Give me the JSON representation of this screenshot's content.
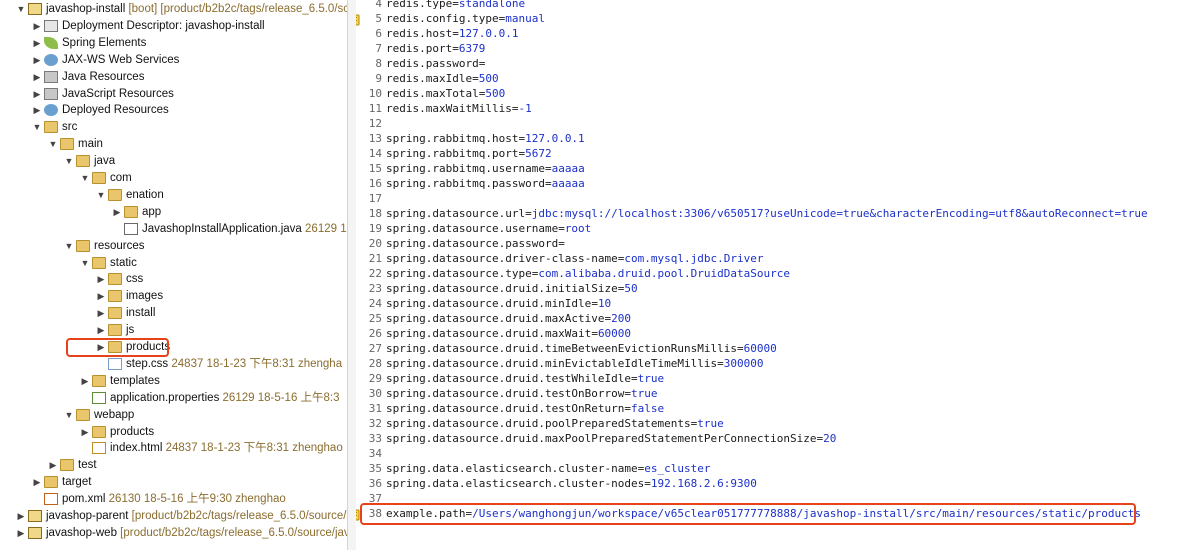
{
  "project_explorer": {
    "items": [
      {
        "label": "javashop-install",
        "annotation": "[boot] [product/b2b2c/tags/release_6.5.0/sc",
        "icon": "project-icon",
        "depth": 0,
        "expanded": true
      },
      {
        "label": "Deployment Descriptor: javashop-install",
        "annotation": "",
        "icon": "deployment-descriptor-icon",
        "depth": 1,
        "expanded": false
      },
      {
        "label": "Spring Elements",
        "annotation": "",
        "icon": "spring-leaf-icon",
        "depth": 1,
        "expanded": false
      },
      {
        "label": "JAX-WS Web Services",
        "annotation": "",
        "icon": "web-services-icon",
        "depth": 1,
        "expanded": false
      },
      {
        "label": "Java Resources",
        "annotation": "",
        "icon": "java-resources-icon",
        "depth": 1,
        "expanded": false
      },
      {
        "label": "JavaScript Resources",
        "annotation": "",
        "icon": "javascript-resources-icon",
        "depth": 1,
        "expanded": false
      },
      {
        "label": "Deployed Resources",
        "annotation": "",
        "icon": "deployed-resources-icon",
        "depth": 1,
        "expanded": false
      },
      {
        "label": "src",
        "annotation": "",
        "icon": "folder-icon",
        "depth": 1,
        "expanded": true
      },
      {
        "label": "main",
        "annotation": "",
        "icon": "folder-icon",
        "depth": 2,
        "expanded": true
      },
      {
        "label": "java",
        "annotation": "",
        "icon": "folder-icon",
        "depth": 3,
        "expanded": true
      },
      {
        "label": "com",
        "annotation": "",
        "icon": "folder-icon",
        "depth": 4,
        "expanded": true
      },
      {
        "label": "enation",
        "annotation": "",
        "icon": "folder-icon",
        "depth": 5,
        "expanded": true
      },
      {
        "label": "app",
        "annotation": "",
        "icon": "folder-icon",
        "depth": 6,
        "expanded": false
      },
      {
        "label": "JavashopInstallApplication.java",
        "annotation": "26129  18",
        "icon": "java-file-icon",
        "depth": 6,
        "expanded": null
      },
      {
        "label": "resources",
        "annotation": "",
        "icon": "folder-icon",
        "depth": 3,
        "expanded": true
      },
      {
        "label": "static",
        "annotation": "",
        "icon": "folder-icon",
        "depth": 4,
        "expanded": true
      },
      {
        "label": "css",
        "annotation": "",
        "icon": "folder-icon",
        "depth": 5,
        "expanded": false
      },
      {
        "label": "images",
        "annotation": "",
        "icon": "folder-icon",
        "depth": 5,
        "expanded": false
      },
      {
        "label": "install",
        "annotation": "",
        "icon": "folder-icon",
        "depth": 5,
        "expanded": false
      },
      {
        "label": "js",
        "annotation": "",
        "icon": "folder-icon",
        "depth": 5,
        "expanded": false
      },
      {
        "label": "products",
        "annotation": "",
        "icon": "folder-icon",
        "depth": 5,
        "expanded": false
      },
      {
        "label": "step.css",
        "annotation": "24837  18-1-23 下午8:31  zhengha",
        "icon": "css-file-icon",
        "depth": 5,
        "expanded": null
      },
      {
        "label": "templates",
        "annotation": "",
        "icon": "folder-icon",
        "depth": 4,
        "expanded": false
      },
      {
        "label": "application.properties",
        "annotation": "26129  18-5-16 上午8:3",
        "icon": "properties-file-icon",
        "depth": 4,
        "expanded": null
      },
      {
        "label": "webapp",
        "annotation": "",
        "icon": "folder-icon",
        "depth": 3,
        "expanded": true
      },
      {
        "label": "products",
        "annotation": "",
        "icon": "folder-icon",
        "depth": 4,
        "expanded": false
      },
      {
        "label": "index.html",
        "annotation": "24837  18-1-23 下午8:31  zhenghao",
        "icon": "html-file-icon",
        "depth": 4,
        "expanded": null
      },
      {
        "label": "test",
        "annotation": "",
        "icon": "folder-icon",
        "depth": 2,
        "expanded": false
      },
      {
        "label": "target",
        "annotation": "",
        "icon": "folder-icon",
        "depth": 1,
        "expanded": false
      },
      {
        "label": "pom.xml",
        "annotation": "26130  18-5-16 上午9:30  zhenghao",
        "icon": "xml-file-icon",
        "depth": 1,
        "expanded": null
      },
      {
        "label": "javashop-parent",
        "annotation": "[product/b2b2c/tags/release_6.5.0/source/p",
        "icon": "project-icon",
        "depth": 0,
        "expanded": false
      },
      {
        "label": "javashop-web",
        "annotation": "[product/b2b2c/tags/release_6.5.0/source/jav",
        "icon": "project-icon",
        "depth": 0,
        "expanded": false
      }
    ]
  },
  "editor": {
    "lines": [
      {
        "num": "4",
        "key": "redis.type",
        "value": "standalone"
      },
      {
        "num": "5",
        "key": "redis.config.type",
        "value": "manual"
      },
      {
        "num": "6",
        "key": "redis.host",
        "value": "127.0.0.1"
      },
      {
        "num": "7",
        "key": "redis.port",
        "value": "6379"
      },
      {
        "num": "8",
        "key": "redis.password",
        "value": ""
      },
      {
        "num": "9",
        "key": "redis.maxIdle",
        "value": "500"
      },
      {
        "num": "10",
        "key": "redis.maxTotal",
        "value": "500"
      },
      {
        "num": "11",
        "key": "redis.maxWaitMillis",
        "value": "-1"
      },
      {
        "num": "12",
        "key": "",
        "value": ""
      },
      {
        "num": "13",
        "key": "spring.rabbitmq.host",
        "value": "127.0.0.1"
      },
      {
        "num": "14",
        "key": "spring.rabbitmq.port",
        "value": "5672"
      },
      {
        "num": "15",
        "key": "spring.rabbitmq.username",
        "value": "aaaaa"
      },
      {
        "num": "16",
        "key": "spring.rabbitmq.password",
        "value": "aaaaa"
      },
      {
        "num": "17",
        "key": "",
        "value": ""
      },
      {
        "num": "18",
        "key": "spring.datasource.url",
        "value": "jdbc:mysql://localhost:3306/v650517?useUnicode=true&characterEncoding=utf8&autoReconnect=true"
      },
      {
        "num": "19",
        "key": "spring.datasource.username",
        "value": "root"
      },
      {
        "num": "20",
        "key": "spring.datasource.password",
        "value": ""
      },
      {
        "num": "21",
        "key": "spring.datasource.driver-class-name",
        "value": "com.mysql.jdbc.Driver"
      },
      {
        "num": "22",
        "key": "spring.datasource.type",
        "value": "com.alibaba.druid.pool.DruidDataSource"
      },
      {
        "num": "23",
        "key": "spring.datasource.druid.initialSize",
        "value": "50"
      },
      {
        "num": "24",
        "key": "spring.datasource.druid.minIdle",
        "value": "10"
      },
      {
        "num": "25",
        "key": "spring.datasource.druid.maxActive",
        "value": "200"
      },
      {
        "num": "26",
        "key": "spring.datasource.druid.maxWait",
        "value": "60000"
      },
      {
        "num": "27",
        "key": "spring.datasource.druid.timeBetweenEvictionRunsMillis",
        "value": "60000"
      },
      {
        "num": "28",
        "key": "spring.datasource.druid.minEvictableIdleTimeMillis",
        "value": "300000"
      },
      {
        "num": "29",
        "key": "spring.datasource.druid.testWhileIdle",
        "value": "true"
      },
      {
        "num": "30",
        "key": "spring.datasource.druid.testOnBorrow",
        "value": "true"
      },
      {
        "num": "31",
        "key": "spring.datasource.druid.testOnReturn",
        "value": "false"
      },
      {
        "num": "32",
        "key": "spring.datasource.druid.poolPreparedStatements",
        "value": "true"
      },
      {
        "num": "33",
        "key": "spring.datasource.druid.maxPoolPreparedStatementPerConnectionSize",
        "value": "20"
      },
      {
        "num": "34",
        "key": "",
        "value": ""
      },
      {
        "num": "35",
        "key": "spring.data.elasticsearch.cluster-name",
        "value": "es_cluster"
      },
      {
        "num": "36",
        "key": "spring.data.elasticsearch.cluster-nodes",
        "value": "192.168.2.6:9300"
      },
      {
        "num": "37",
        "key": "",
        "value": ""
      },
      {
        "num": "38",
        "key": "example.path",
        "value": "/Users/wanghongjun/workspace/v65clear051777778888/javashop-install/src/main/resources/static/products"
      }
    ]
  }
}
